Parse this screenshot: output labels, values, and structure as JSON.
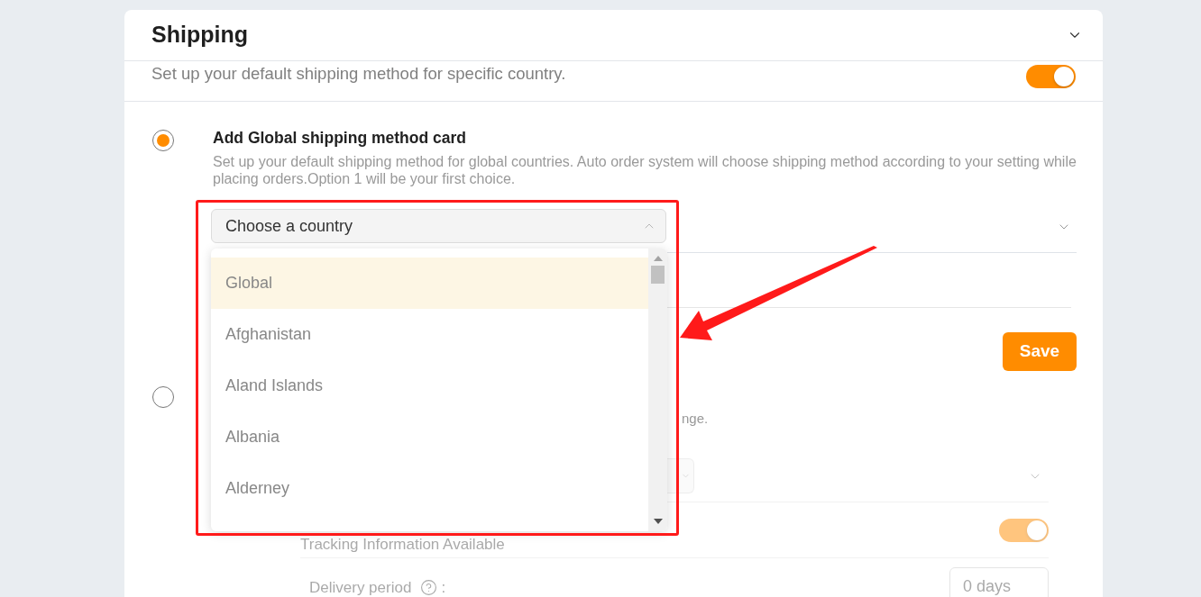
{
  "card": {
    "title": "Shipping"
  },
  "specific_country": {
    "description": "Set up your default shipping method for specific country.",
    "on": true
  },
  "options": [
    {
      "selected": true,
      "title": "Add Global shipping method card",
      "description": "Set up your default shipping method for global countries. Auto order system will choose shipping method according to your setting while placing orders.Option 1 will be your first choice.",
      "country_select": {
        "placeholder": "Choose a country",
        "expanded": true,
        "options": [
          {
            "label": "Global",
            "selected": true
          },
          {
            "label": "Afghanistan",
            "selected": false
          },
          {
            "label": "Aland Islands",
            "selected": false
          },
          {
            "label": "Albania",
            "selected": false
          },
          {
            "label": "Alderney",
            "selected": false
          }
        ]
      },
      "save_button": "Save"
    },
    {
      "selected": false,
      "description_fragment": "nge.",
      "tracking": {
        "label": "Tracking Information Available",
        "on": true
      },
      "delivery_period": {
        "label": "Delivery period",
        "separator": ":",
        "value": "0 days"
      }
    }
  ]
}
